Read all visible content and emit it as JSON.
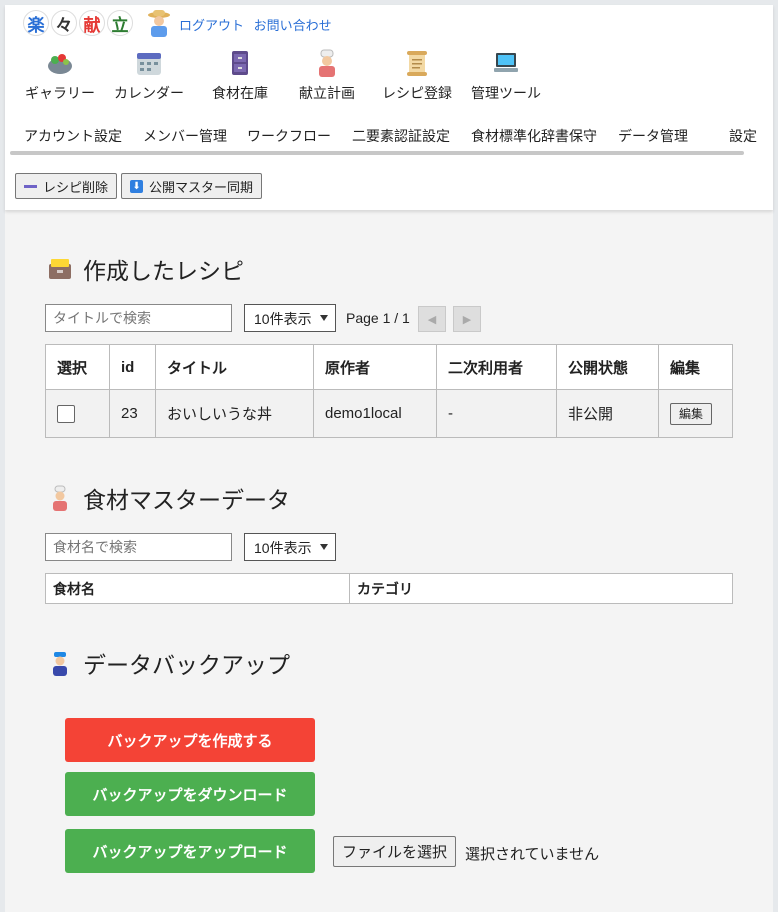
{
  "logo": {
    "chars": [
      "楽",
      "々",
      "献",
      "立"
    ]
  },
  "toplinks": {
    "logout": "ログアウト",
    "contact": "お問い合わせ"
  },
  "nav": [
    {
      "label": "ギャラリー",
      "icon": "salad-bowl-icon"
    },
    {
      "label": "カレンダー",
      "icon": "calendar-icon"
    },
    {
      "label": "食材在庫",
      "icon": "cabinet-icon"
    },
    {
      "label": "献立計画",
      "icon": "cook-icon"
    },
    {
      "label": "レシピ登録",
      "icon": "scroll-icon"
    },
    {
      "label": "管理ツール",
      "icon": "laptop-icon"
    }
  ],
  "tabs": [
    "アカウント設定",
    "メンバー管理",
    "ワークフロー",
    "二要素認証設定",
    "食材標準化辞書保守",
    "データ管理",
    "設定"
  ],
  "actions": {
    "delete": "レシピ削除",
    "sync": "公開マスター同期"
  },
  "recipes": {
    "title": "作成したレシピ",
    "search_placeholder": "タイトルで検索",
    "page_size": "10件表示",
    "page": "Page 1 / 1",
    "headers": [
      "選択",
      "id",
      "タイトル",
      "原作者",
      "二次利用者",
      "公開状態",
      "編集"
    ],
    "rows": [
      {
        "id": "23",
        "title": "おいしいうな丼",
        "author": "demo1local",
        "secondary": "-",
        "status": "非公開",
        "edit": "編集"
      }
    ]
  },
  "ingredients": {
    "title": "食材マスターデータ",
    "search_placeholder": "食材名で検索",
    "page_size": "10件表示",
    "headers": [
      "食材名",
      "カテゴリ"
    ]
  },
  "backup": {
    "title": "データバックアップ",
    "create": "バックアップを作成する",
    "download": "バックアップをダウンロード",
    "upload": "バックアップをアップロード",
    "file_button": "ファイルを選択",
    "file_status": "選択されていません"
  },
  "colors": {
    "red": "#f44336",
    "green": "#4caf50",
    "link": "#2a6fd6"
  }
}
